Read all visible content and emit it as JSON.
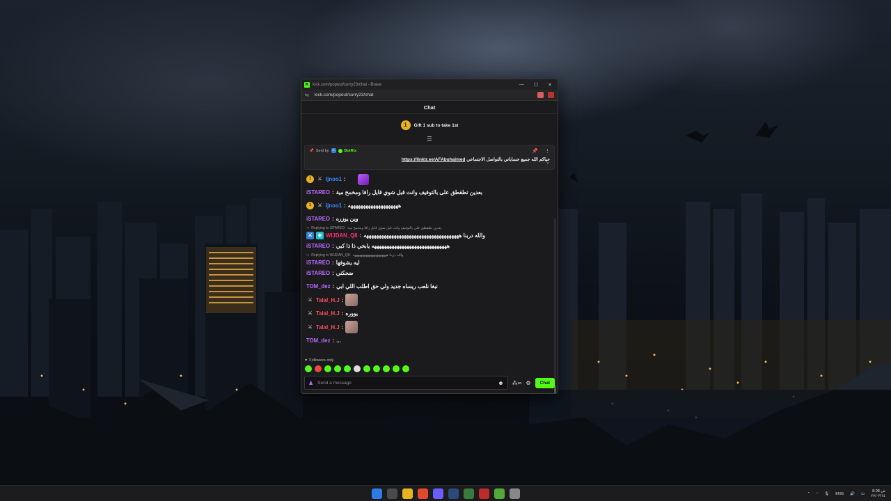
{
  "browser": {
    "title": "kick.com/popout/curry23/chat - Brave",
    "url": "kick.com/popout/curry23/chat",
    "controls": {
      "minimize": "—",
      "maximize": "☐",
      "close": "✕"
    }
  },
  "chat": {
    "header": "Chat",
    "gift": {
      "badge": "1",
      "text": "Gift 1 sub to take 1st"
    },
    "pinned": {
      "sent_by_label": "Sent by",
      "sender": "BotRix",
      "message": "حياكم الله جميع حساباتي بالتواصل الاجتماعي",
      "link": "https://linktr.ee/AFAbuhaimed"
    },
    "messages": [
      {
        "user": "ljnoo1",
        "text": "",
        "badge": "1"
      },
      {
        "user": "iSTAREO",
        "text": "بعدين تطقطق على بالتوفيف وانت قبل شوي قايل رافا ومخمخ مية"
      },
      {
        "user": "ljnoo1",
        "text": "ههههههههههههههههههههه",
        "badge": "1"
      },
      {
        "user": "iSTAREO",
        "text": "وين يوزره"
      },
      {
        "reply_label": "Replying to iSTAREO:",
        "reply_text": "بعدين تطقطق على بالتوفيف وانت قبل شوي قايل رافا ومخمخ مية",
        "user": "WIJDAN_Q8",
        "text": "والله دربنا ههههههههههههههههههههههههههههههههههههههه"
      },
      {
        "user": "iSTAREO",
        "text": "ههههههههههههههههههههههههههههههه يابخي ذا ذا كبي"
      },
      {
        "reply_label": "Replying to WIJDAN_Q8:",
        "reply_text": "والله دربنا هههههههههههههههههههههه",
        "user": "iSTAREO",
        "text": "ليه يشوفها"
      },
      {
        "user": "iSTAREO",
        "text": "ضحكني"
      },
      {
        "user": "TOM_dez",
        "text": "نبغا نلعب ريساه جديد ولي حق اطلب اللي ابي"
      },
      {
        "user": "Talal_H.J",
        "text": ""
      },
      {
        "user": "Talal_H.J",
        "text": "يووره"
      },
      {
        "user": "Talal_H.J",
        "text": ""
      },
      {
        "user": "TOM_dez",
        "text": "..."
      }
    ],
    "followers_only": "Followers only",
    "input_placeholder": "Send a message",
    "send_button": "Chat"
  },
  "taskbar": {
    "language": "ENG",
    "time": "8:08 ص",
    "date": "٢٧/٠٣/١٤"
  },
  "colors": {
    "kick_green": "#53fc18",
    "user_blue": "#3b8cff",
    "user_purple": "#b96bff",
    "user_pink": "#ff2f6e"
  }
}
